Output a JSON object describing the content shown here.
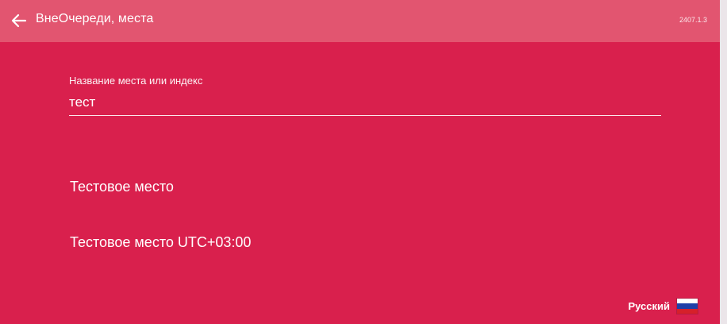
{
  "header": {
    "title": "ВнеОчереди, места",
    "version": "2407.1.3"
  },
  "search": {
    "label": "Название места или индекс",
    "value": "тест"
  },
  "results": [
    {
      "label": "Тестовое место"
    },
    {
      "label": "Тестовое место UTC+03:00"
    }
  ],
  "language": {
    "label": "Русский",
    "flag_colors": [
      "#ffffff",
      "#1f3fa8",
      "#d6202a"
    ]
  },
  "colors": {
    "background": "#d9204d",
    "app_bar": "#e25570"
  }
}
